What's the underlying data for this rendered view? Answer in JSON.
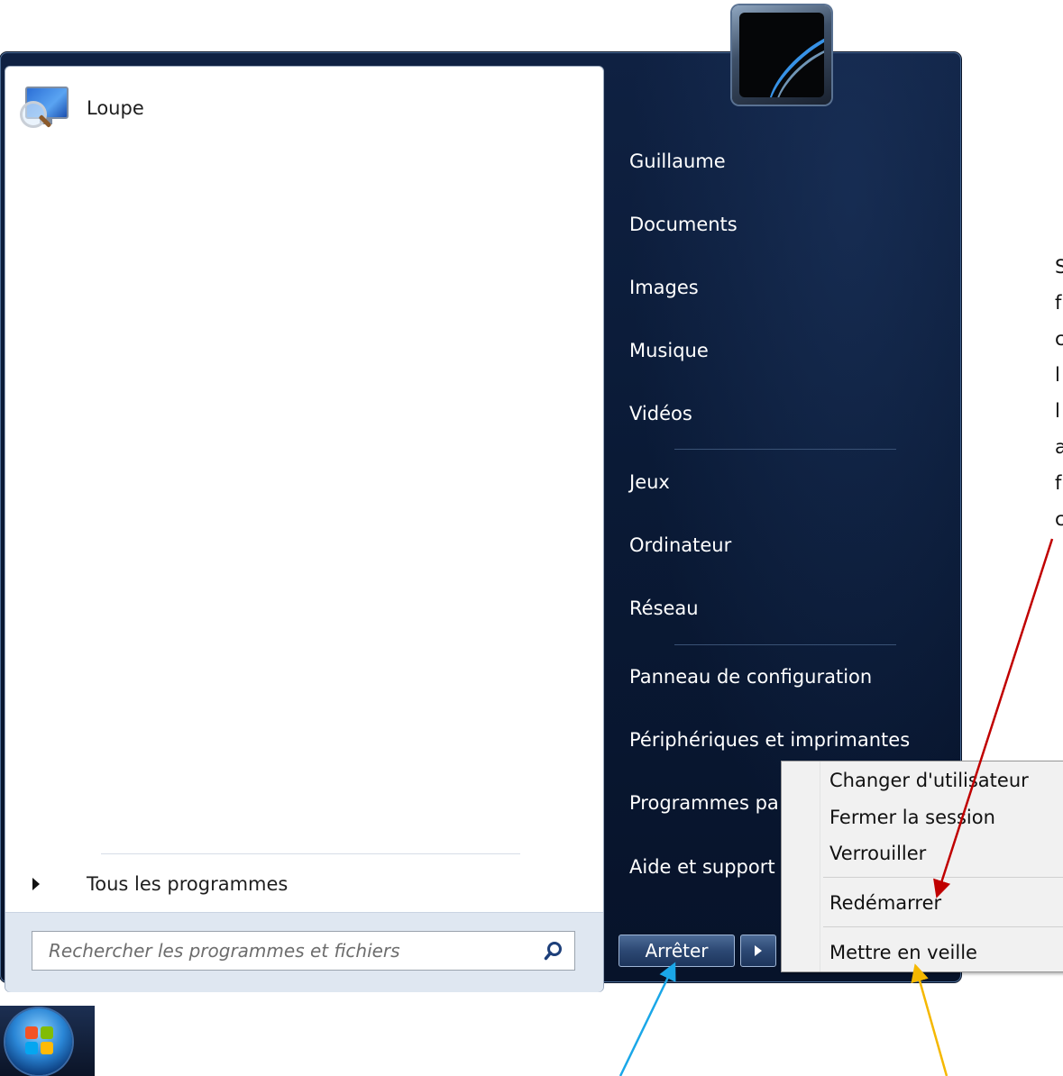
{
  "left_panel": {
    "pinned": [
      {
        "label": "Loupe",
        "icon": "magnifier-icon"
      }
    ],
    "all_programs": "Tous les programmes",
    "search": {
      "placeholder": "Rechercher les programmes et fichiers",
      "value": ""
    }
  },
  "right_panel": {
    "items": [
      "Guillaume",
      "Documents",
      "Images",
      "Musique",
      "Vidéos",
      "Jeux",
      "Ordinateur",
      "Réseau",
      "Panneau de configuration",
      "Périphériques et imprimantes",
      "Programmes pa",
      "Aide et support"
    ],
    "power_button": "Arrêter"
  },
  "context_menu": {
    "items": [
      "Changer d'utilisateur",
      "Fermer la session",
      "Verrouiller",
      "Redémarrer",
      "Mettre en veille"
    ]
  },
  "annotation_letters": [
    "S",
    "f",
    "c",
    "l",
    "l",
    "a",
    "f",
    "c"
  ],
  "arrow_colors": {
    "red": "#c00000",
    "blue": "#1aa7e8",
    "yellow": "#f5b800"
  }
}
